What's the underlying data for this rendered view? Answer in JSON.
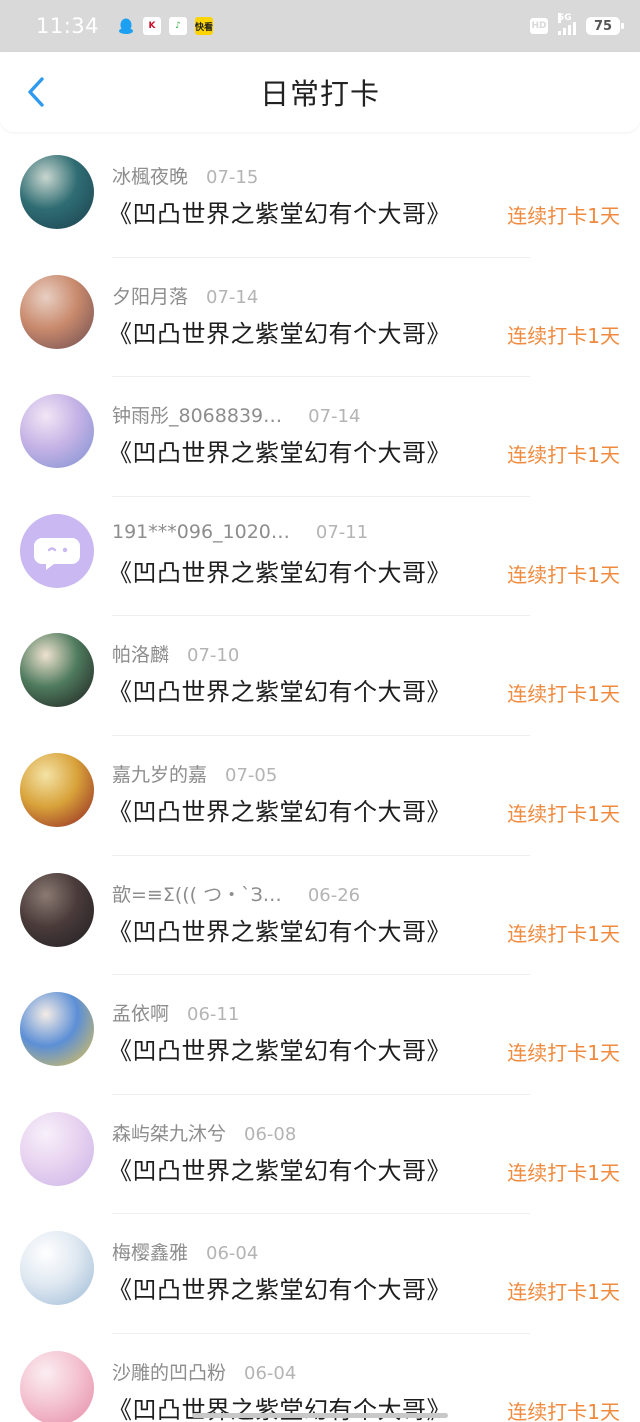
{
  "status_bar": {
    "time": "11:34",
    "apps": [
      {
        "name": "qq-icon",
        "glyph": "",
        "bg": "#d9d9d9",
        "fg": "#1da0f2"
      },
      {
        "name": "kfc-icon",
        "glyph": "K",
        "bg": "#ffffff",
        "fg": "#c8102e"
      },
      {
        "name": "music-icon",
        "glyph": "♪",
        "bg": "#ffffff",
        "fg": "#33b44a"
      },
      {
        "name": "kuaikan-icon",
        "glyph": "快看",
        "bg": "#ffd400",
        "fg": "#222222"
      }
    ],
    "hd": "HD",
    "network": "5G",
    "battery": "75"
  },
  "nav": {
    "title": "日常打卡",
    "back_icon": "chevron-left-icon",
    "accent": "#2e9bf0"
  },
  "checkins": [
    {
      "user": "冰楓夜晚",
      "date": "07-15",
      "book": "《凹凸世界之紫堂幻有个大哥》",
      "streak": "连续打卡1天",
      "avatar_colors": [
        "#1b3f4d",
        "#2f6d73",
        "#c9d6cf"
      ]
    },
    {
      "user": "夕阳月落",
      "date": "07-14",
      "book": "《凹凸世界之紫堂幻有个大哥》",
      "streak": "连续打卡1天",
      "avatar_colors": [
        "#6b4a4f",
        "#c98a6d",
        "#e8cfc3"
      ]
    },
    {
      "user": "钟雨彤_8068839…",
      "date": "07-14",
      "book": "《凹凸世界之紫堂幻有个大哥》",
      "streak": "连续打卡1天",
      "avatar_colors": [
        "#7b8fd0",
        "#c6b3e6",
        "#f2e6f5"
      ]
    },
    {
      "user": "191***096_1020…",
      "date": "07-11",
      "book": "《凹凸世界之紫堂幻有个大哥》",
      "streak": "连续打卡1天",
      "avatar_colors": [
        "#c9b8f2",
        "#c9b8f2",
        "#c9b8f2"
      ],
      "default_avatar": true
    },
    {
      "user": "帕洛麟",
      "date": "07-10",
      "book": "《凹凸世界之紫堂幻有个大哥》",
      "streak": "连续打卡1天",
      "avatar_colors": [
        "#1c1c1c",
        "#4f7b5e",
        "#efe2cf"
      ]
    },
    {
      "user": "嘉九岁的嘉",
      "date": "07-05",
      "book": "《凹凸世界之紫堂幻有个大哥》",
      "streak": "连续打卡1天",
      "avatar_colors": [
        "#8e1f22",
        "#d8a23a",
        "#f4e3a6"
      ]
    },
    {
      "user": "歆=≡Σ((( つ・`З…",
      "date": "06-26",
      "book": "《凹凸世界之紫堂幻有个大哥》",
      "streak": "连续打卡1天",
      "avatar_colors": [
        "#1e1e22",
        "#4a3b3a",
        "#8b7a72"
      ]
    },
    {
      "user": "孟依啊",
      "date": "06-11",
      "book": "《凹凸世界之紫堂幻有个大哥》",
      "streak": "连续打卡1天",
      "avatar_colors": [
        "#e9c64c",
        "#5c8fd6",
        "#f4ece6"
      ]
    },
    {
      "user": "森屿桀九沐兮",
      "date": "06-08",
      "book": "《凹凸世界之紫堂幻有个大哥》",
      "streak": "连续打卡1天",
      "avatar_colors": [
        "#c9b3e8",
        "#e8d3f0",
        "#f7f0fa"
      ]
    },
    {
      "user": "梅樱鑫雅",
      "date": "06-04",
      "book": "《凹凸世界之紫堂幻有个大哥》",
      "streak": "连续打卡1天",
      "avatar_colors": [
        "#9bb9d6",
        "#dfe8f1",
        "#ffffff"
      ]
    },
    {
      "user": "沙雕的凹凸粉",
      "date": "06-04",
      "book": "《凹凸世界之紫堂幻有个大哥》",
      "streak": "连续打卡1天",
      "avatar_colors": [
        "#e48aa5",
        "#f4c3d2",
        "#fbeef2"
      ]
    }
  ]
}
